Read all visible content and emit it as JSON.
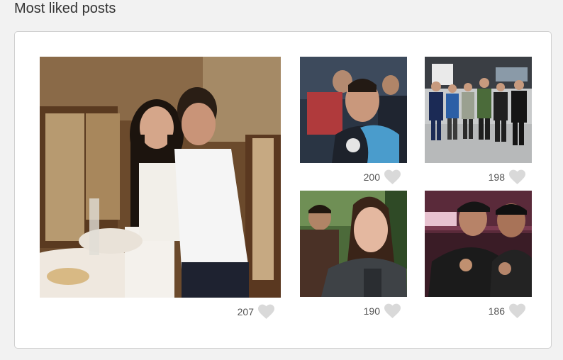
{
  "page": {
    "title": "Most liked posts"
  },
  "posts": [
    {
      "likes": "207",
      "photo": "couple-dinner-photo",
      "icon": "heart-icon"
    },
    {
      "likes": "200",
      "photo": "man-with-towel-photo",
      "icon": "heart-icon"
    },
    {
      "likes": "198",
      "photo": "group-gym-photo",
      "icon": "heart-icon"
    },
    {
      "likes": "190",
      "photo": "outdoor-selfie-photo",
      "icon": "heart-icon"
    },
    {
      "likes": "186",
      "photo": "arena-selfie-photo",
      "icon": "heart-icon"
    }
  ],
  "colors": {
    "heart": "#d9d9d9",
    "card_border": "#cfcfcf",
    "background": "#f2f2f2"
  }
}
